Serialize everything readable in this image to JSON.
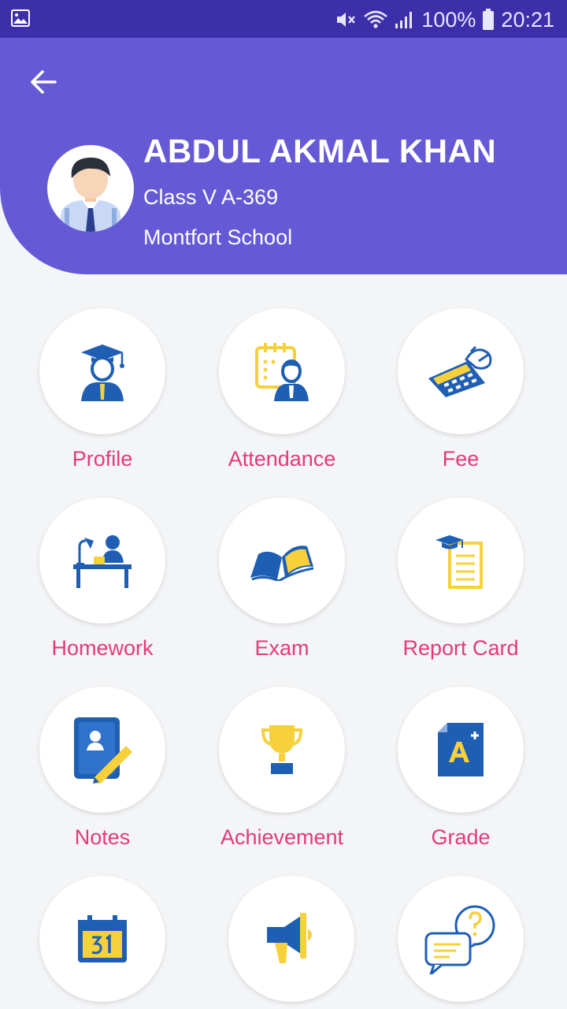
{
  "status_bar": {
    "battery": "100%",
    "time": "20:21",
    "icons": [
      "gallery-icon",
      "mute-icon",
      "wifi-icon",
      "signal-icon",
      "battery-icon"
    ]
  },
  "header": {
    "back_icon": "arrow-left-icon",
    "name": "ABDUL AKMAL KHAN",
    "class_info": "Class V A-369",
    "school": "Montfort School"
  },
  "menu": {
    "profile": "Profile",
    "attendance": "Attendance",
    "fee": "Fee",
    "homework": "Homework",
    "exam": "Exam",
    "report_card": "Report Card",
    "notes": "Notes",
    "achievement": "Achievement",
    "grade": "Grade"
  },
  "colors": {
    "status_bar": "#3d2eaa",
    "header": "#6659d6",
    "label": "#e43a7d",
    "icon_blue": "#1f5fb3",
    "icon_yellow": "#f7d13c"
  }
}
